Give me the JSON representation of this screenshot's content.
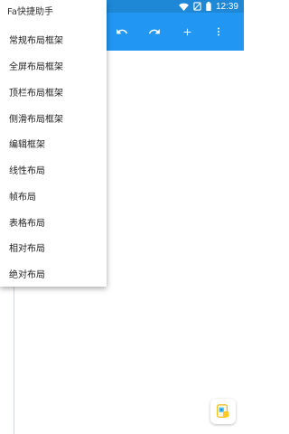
{
  "status_bar": {
    "time": "12:39",
    "icons": [
      "screenshot-icon",
      "android-icon",
      "wifi-icon",
      "no-sim-icon",
      "battery-icon"
    ]
  },
  "toolbar": {
    "undo_icon": "undo-icon",
    "redo_icon": "redo-icon",
    "add_icon": "add-icon",
    "more_icon": "more-vertical-icon"
  },
  "menu": {
    "header": "Fa快捷助手",
    "items": [
      "常规布局框架",
      "全屏布局框架",
      "顶栏布局框架",
      "侧滑布局框架",
      "编辑框架",
      "线性布局",
      "帧布局",
      "表格布局",
      "相对布局",
      "绝对布局"
    ]
  },
  "fab": {
    "icon": "app-helper-icon"
  },
  "colors": {
    "toolbar": "#2196f3",
    "statusbar": "#1e88d6",
    "background": "#ffffff"
  }
}
